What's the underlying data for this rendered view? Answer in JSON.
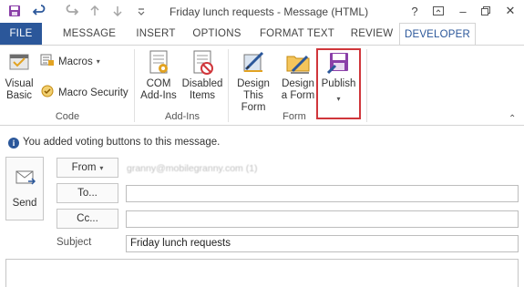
{
  "window": {
    "title": "Friday lunch requests - Message (HTML)"
  },
  "tabs": [
    {
      "label": "FILE"
    },
    {
      "label": "MESSAGE"
    },
    {
      "label": "INSERT"
    },
    {
      "label": "OPTIONS"
    },
    {
      "label": "FORMAT TEXT"
    },
    {
      "label": "REVIEW"
    },
    {
      "label": "DEVELOPER"
    }
  ],
  "ribbon": {
    "code": {
      "group_label": "Code",
      "visual_basic_line1": "Visual",
      "visual_basic_line2": "Basic",
      "macros": "Macros",
      "macro_security": "Macro Security"
    },
    "addins": {
      "group_label": "Add-Ins",
      "com_line1": "COM",
      "com_line2": "Add-Ins",
      "disabled_line1": "Disabled",
      "disabled_line2": "Items"
    },
    "form": {
      "group_label": "Form",
      "design_this_line1": "Design",
      "design_this_line2": "This Form",
      "design_a_line1": "Design",
      "design_a_line2": "a Form",
      "publish": "Publish"
    }
  },
  "infobar": {
    "message": "You added voting buttons to this message."
  },
  "compose": {
    "send_label": "Send",
    "from_label": "From",
    "from_address": "granny@mobilegranny.com (1)",
    "to_label": "To...",
    "cc_label": "Cc...",
    "to_value": "",
    "cc_value": "",
    "subject_label": "Subject",
    "subject_value": "Friday lunch requests"
  },
  "colors": {
    "accent": "#2b579a",
    "highlight": "#d0363b"
  },
  "icons": [
    "save-icon",
    "undo-icon",
    "redo-icon",
    "up-arrow-icon",
    "down-arrow-icon",
    "help-icon",
    "ribbon-display-icon",
    "minimize-icon",
    "restore-icon",
    "close-icon",
    "visual-basic-icon",
    "macros-icon",
    "macro-security-icon",
    "com-addins-icon",
    "disabled-items-icon",
    "design-this-form-icon",
    "design-a-form-icon",
    "publish-icon",
    "info-icon",
    "send-envelope-icon"
  ]
}
